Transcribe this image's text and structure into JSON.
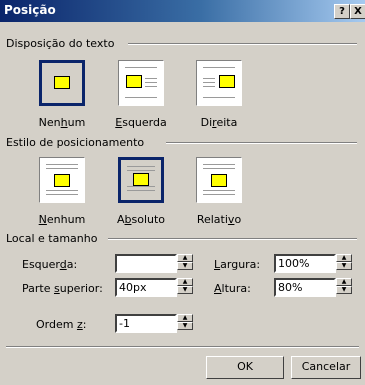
{
  "window": {
    "title": "Posição",
    "help_label": "?",
    "close_label": "X"
  },
  "text_layout": {
    "group_label": "Disposição do texto",
    "options": [
      {
        "pre": "Nen",
        "key": "h",
        "post": "um"
      },
      {
        "pre": "",
        "key": "E",
        "post": "squerda"
      },
      {
        "pre": "Di",
        "key": "r",
        "post": "eita"
      }
    ]
  },
  "positioning": {
    "group_label": "Estilo de posicionamento",
    "options": [
      {
        "pre": "",
        "key": "N",
        "post": "enhum"
      },
      {
        "pre": "A",
        "key": "b",
        "post": "soluto"
      },
      {
        "pre": "Relati",
        "key": "v",
        "post": "o"
      }
    ]
  },
  "size": {
    "group_label": "Local e tamanho",
    "left": {
      "pre": "Esquer",
      "key": "d",
      "post": "a:",
      "value": ""
    },
    "top": {
      "pre": "Parte ",
      "key": "s",
      "post": "uperior:",
      "value": "40px"
    },
    "width": {
      "pre": "",
      "key": "L",
      "post": "argura:",
      "value": "100%"
    },
    "height": {
      "pre": "",
      "key": "A",
      "post": "ltura:",
      "value": "80%"
    },
    "zorder": {
      "pre": "Ordem ",
      "key": "z",
      "post": ":",
      "value": "-1"
    }
  },
  "buttons": {
    "ok": "OK",
    "cancel": "Cancelar"
  }
}
